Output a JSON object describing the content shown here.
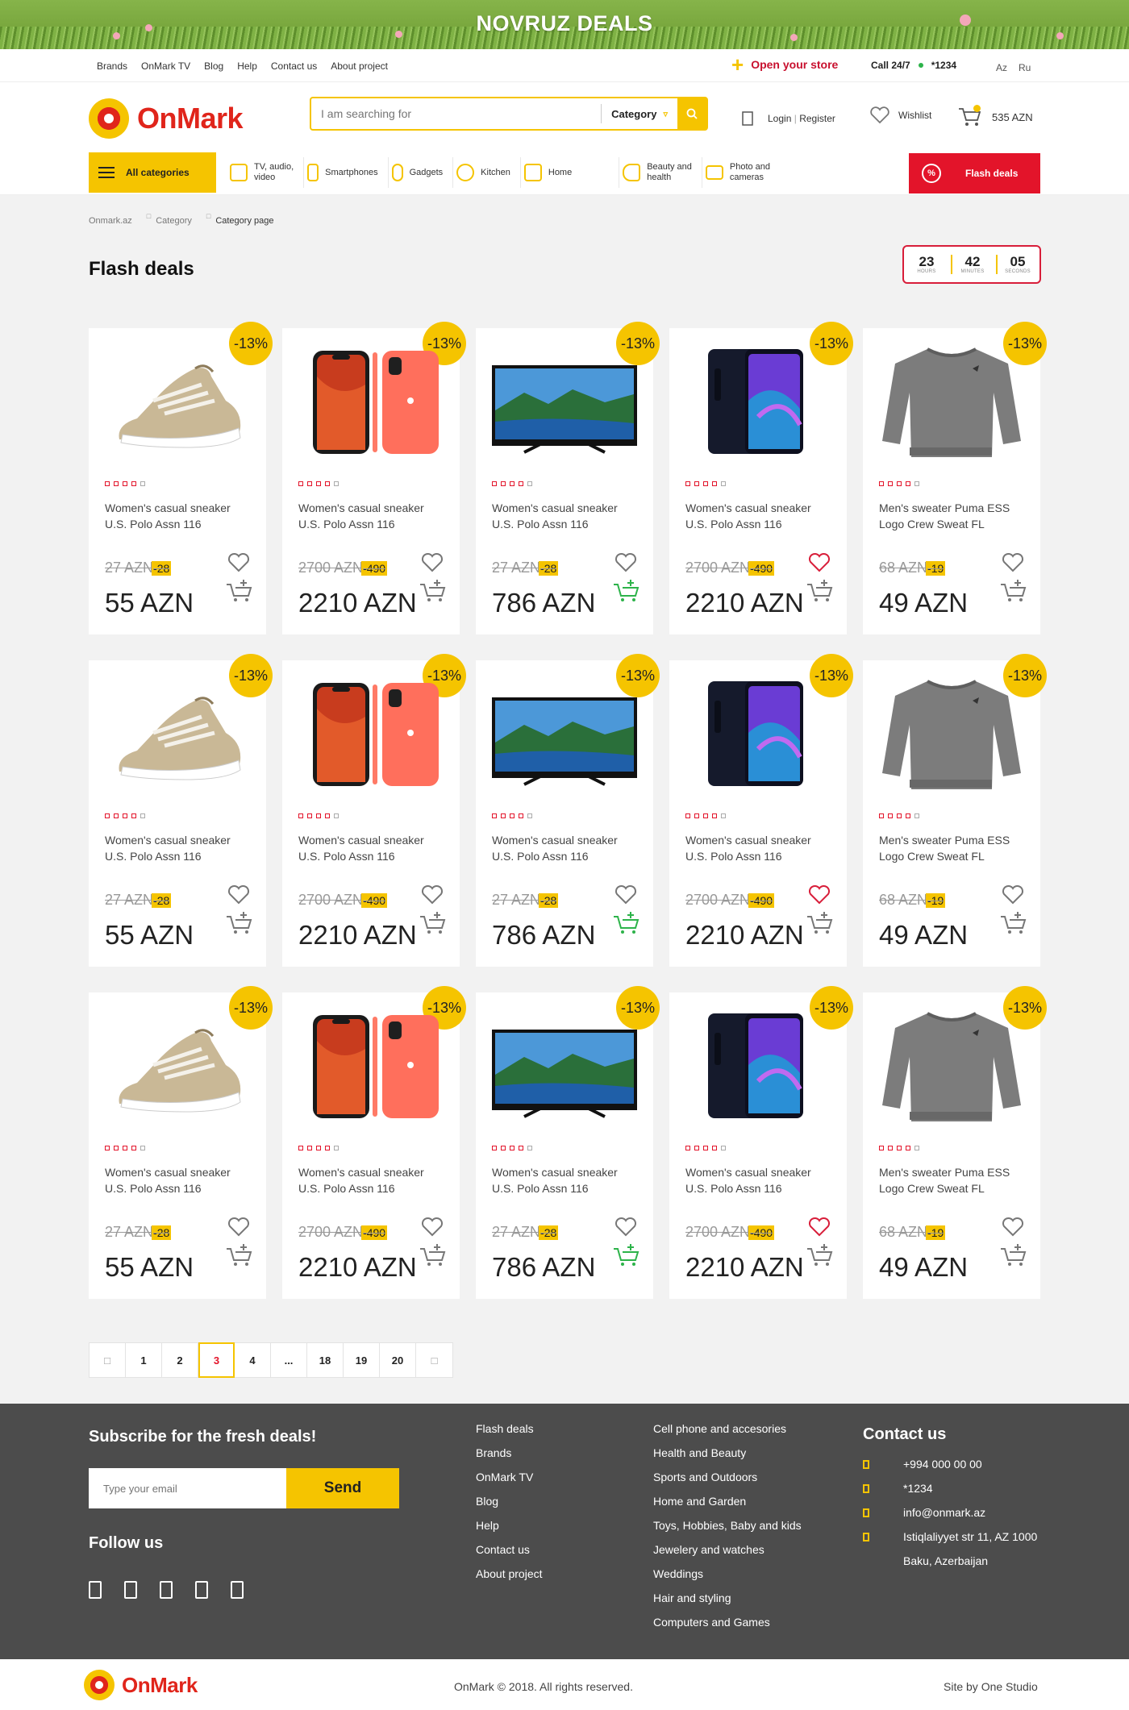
{
  "banner": {
    "title": "NOVRUZ DEALS"
  },
  "topnav": [
    "Brands",
    "OnMark TV",
    "Blog",
    "Help",
    "Contact us",
    "About project"
  ],
  "open_store": "Open your store",
  "call": {
    "label": "Call 24/7",
    "number": "*1234"
  },
  "langs": [
    "Az",
    "Ru"
  ],
  "logo": "OnMark",
  "search": {
    "placeholder": "I am searching for",
    "category": "Category"
  },
  "login": {
    "login": "Login",
    "sep": "|",
    "register": "Register"
  },
  "wishlist": "Wishlist",
  "cart_total": "535 AZN",
  "all_categories": "All categories",
  "categories": [
    {
      "label": "TV, audio,\nvideo"
    },
    {
      "label": "Smartphones"
    },
    {
      "label": "Gadgets"
    },
    {
      "label": "Kitchen"
    },
    {
      "label": "Home"
    },
    {
      "label": "Beauty and\nhealth"
    },
    {
      "label": "Photo and\ncameras"
    }
  ],
  "flash_deals_btn": "Flash deals",
  "breadcrumb": [
    "Onmark.az",
    "Category",
    "Category page"
  ],
  "page_title": "Flash deals",
  "timer": [
    {
      "value": "23",
      "label": "HOURS"
    },
    {
      "value": "42",
      "label": "MINUTES"
    },
    {
      "value": "05",
      "label": "SECONDS"
    }
  ],
  "products": [
    {
      "kind": "sneaker",
      "badge": "-13%",
      "name": "Women's casual sneaker U.S. Polo Assn 116",
      "old": "27 AZN",
      "disc": "-28",
      "price": "55 AZN",
      "liked": false,
      "in_cart": false,
      "rating": 4
    },
    {
      "kind": "phone",
      "badge": "-13%",
      "name": "Women's casual sneaker U.S. Polo Assn 116",
      "old": "2700 AZN",
      "disc": "-490",
      "price": "2210 AZN",
      "liked": false,
      "in_cart": false,
      "rating": 4
    },
    {
      "kind": "tv",
      "badge": "-13%",
      "name": "Women's casual sneaker U.S. Polo Assn 116",
      "old": "27 AZN",
      "disc": "-28",
      "price": "786 AZN",
      "liked": false,
      "in_cart": true,
      "rating": 4
    },
    {
      "kind": "galaxy",
      "badge": "-13%",
      "name": "Women's casual sneaker U.S. Polo Assn 116",
      "old": "2700 AZN",
      "disc": "-490",
      "price": "2210 AZN",
      "liked": true,
      "in_cart": false,
      "rating": 4
    },
    {
      "kind": "sweater",
      "badge": "-13%",
      "name": "Men's sweater Puma ESS Logo Crew Sweat FL",
      "old": "68 AZN",
      "disc": "-19",
      "price": "49 AZN",
      "liked": false,
      "in_cart": false,
      "rating": 4
    }
  ],
  "pagination": [
    "1",
    "2",
    "3",
    "4",
    "...",
    "18",
    "19",
    "20"
  ],
  "pagination_active": "3",
  "footer": {
    "subscribe_title": "Subscribe for the fresh deals!",
    "email_placeholder": "Type your email",
    "send": "Send",
    "follow_title": "Follow us",
    "col1": [
      "Flash deals",
      "Brands",
      "OnMark TV",
      "Blog",
      "Help",
      "Contact us",
      "About project"
    ],
    "col2": [
      "Cell phone and accesories",
      "Health and Beauty",
      "Sports and Outdoors",
      "Home and Garden",
      "Toys, Hobbies, Baby and kids",
      "Jewelery and watches",
      "Weddings",
      "Hair and styling",
      "Computers and Games"
    ],
    "contact_title": "Contact us",
    "contacts": [
      "+994 000 00 00",
      "*1234",
      "info@onmark.az",
      "Istiqlaliyyet str 11, AZ 1000",
      "Baku, Azerbaijan"
    ]
  },
  "bottom": {
    "logo": "OnMark",
    "copyright": "OnMark © 2018. All rights reserved.",
    "site": "Site by One Studio"
  },
  "colors": {
    "accent": "#f5c400",
    "brand_red": "#e0251b",
    "flash_red": "#e3142a",
    "footer_bg": "#4c4c4c",
    "liked": "#d81e3a",
    "in_cart": "#2db34a"
  }
}
